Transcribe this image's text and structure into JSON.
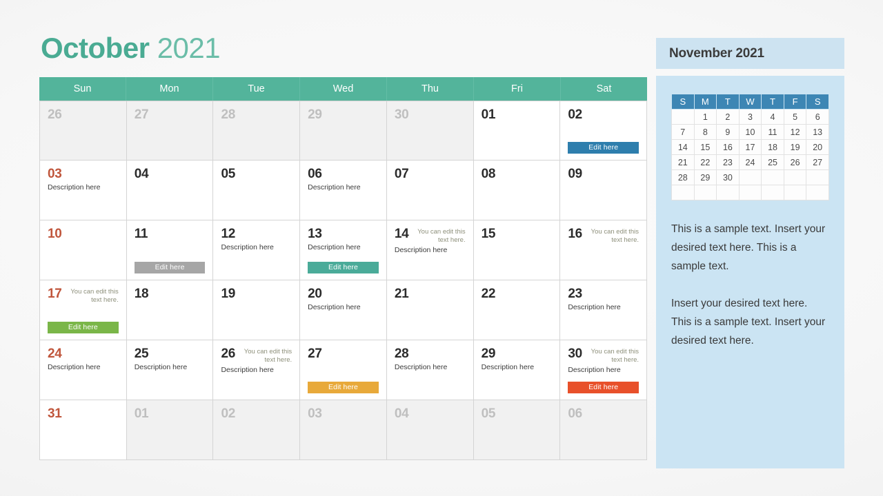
{
  "header": {
    "month": "October",
    "year": "2021"
  },
  "weekdays": [
    "Sun",
    "Mon",
    "Tue",
    "Wed",
    "Thu",
    "Fri",
    "Sat"
  ],
  "colors": {
    "header_teal": "#53b49b",
    "title_green": "#4aab93",
    "sunday_red": "#c0563c",
    "muted_day": "#bfbfbf",
    "panel_blue": "#cbe4f3",
    "mini_header_blue": "#3d86b4",
    "btn_blue": "#2e7ead",
    "btn_gray": "#a6a6a6",
    "btn_teal": "#4aab99",
    "btn_green": "#7ab648",
    "btn_amber": "#e8a93a",
    "btn_red": "#e8502a"
  },
  "labels": {
    "edit_here": "Edit here",
    "description_here": "Description here",
    "editable_note": "You can edit this text here."
  },
  "weeks": [
    [
      {
        "num": "26",
        "out": true,
        "sunday": true
      },
      {
        "num": "27",
        "out": true
      },
      {
        "num": "28",
        "out": true
      },
      {
        "num": "29",
        "out": true
      },
      {
        "num": "30",
        "out": true
      },
      {
        "num": "01"
      },
      {
        "num": "02",
        "button": {
          "label": "Edit here",
          "color": "#2e7ead"
        }
      }
    ],
    [
      {
        "num": "03",
        "sunday": true,
        "desc": "Description here"
      },
      {
        "num": "04"
      },
      {
        "num": "05"
      },
      {
        "num": "06",
        "desc": "Description here"
      },
      {
        "num": "07"
      },
      {
        "num": "08"
      },
      {
        "num": "09"
      }
    ],
    [
      {
        "num": "10",
        "sunday": true
      },
      {
        "num": "11",
        "button": {
          "label": "Edit here",
          "color": "#a6a6a6"
        }
      },
      {
        "num": "12",
        "desc": "Description here"
      },
      {
        "num": "13",
        "desc": "Description here",
        "button": {
          "label": "Edit here",
          "color": "#4aab99"
        }
      },
      {
        "num": "14",
        "note": "You can edit this text here.",
        "desc": "Description here"
      },
      {
        "num": "15"
      },
      {
        "num": "16",
        "note": "You can edit this text here."
      }
    ],
    [
      {
        "num": "17",
        "sunday": true,
        "note": "You can edit this text here.",
        "button": {
          "label": "Edit here",
          "color": "#7ab648"
        }
      },
      {
        "num": "18"
      },
      {
        "num": "19"
      },
      {
        "num": "20",
        "desc": "Description here"
      },
      {
        "num": "21"
      },
      {
        "num": "22"
      },
      {
        "num": "23",
        "desc": "Description here"
      }
    ],
    [
      {
        "num": "24",
        "sunday": true,
        "desc": "Description here"
      },
      {
        "num": "25",
        "desc": "Description here"
      },
      {
        "num": "26",
        "note": "You can edit this text here.",
        "desc": "Description here"
      },
      {
        "num": "27",
        "button": {
          "label": "Edit here",
          "color": "#e8a93a"
        }
      },
      {
        "num": "28",
        "desc": "Description here"
      },
      {
        "num": "29",
        "desc": "Description here"
      },
      {
        "num": "30",
        "note": "You can edit this text here.",
        "desc": "Description here",
        "button": {
          "label": "Edit here",
          "color": "#e8502a"
        }
      }
    ],
    [
      {
        "num": "31",
        "sunday": true
      },
      {
        "num": "01",
        "out": true
      },
      {
        "num": "02",
        "out": true
      },
      {
        "num": "03",
        "out": true
      },
      {
        "num": "04",
        "out": true
      },
      {
        "num": "05",
        "out": true
      },
      {
        "num": "06",
        "out": true
      }
    ]
  ],
  "side": {
    "mini_title": "November 2021",
    "mini_weekdays": [
      "S",
      "M",
      "T",
      "W",
      "T",
      "F",
      "S"
    ],
    "mini_weeks": [
      [
        "",
        "1",
        "2",
        "3",
        "4",
        "5",
        "6"
      ],
      [
        "7",
        "8",
        "9",
        "10",
        "11",
        "12",
        "13"
      ],
      [
        "14",
        "15",
        "16",
        "17",
        "18",
        "19",
        "20"
      ],
      [
        "21",
        "22",
        "23",
        "24",
        "25",
        "26",
        "27"
      ],
      [
        "28",
        "29",
        "30",
        "",
        "",
        "",
        ""
      ],
      [
        "",
        "",
        "",
        "",
        "",
        "",
        ""
      ]
    ],
    "paragraphs": [
      "This is a sample text. Insert your desired text here. This is a sample text.",
      "Insert your desired text here. This is a sample text. Insert your desired text here."
    ]
  }
}
